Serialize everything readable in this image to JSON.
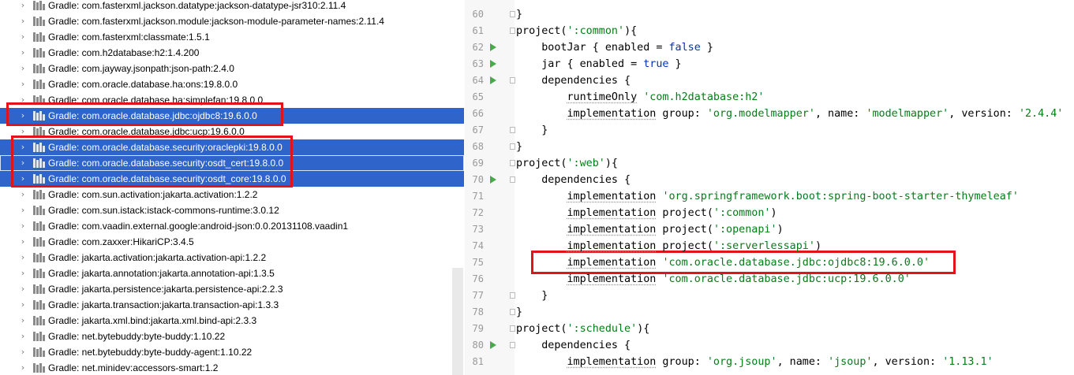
{
  "tree": {
    "items": [
      {
        "label": "Gradle: com.fasterxml.jackson.datatype:jackson-datatype-jsr310:2.11.4",
        "selected": false
      },
      {
        "label": "Gradle: com.fasterxml.jackson.module:jackson-module-parameter-names:2.11.4",
        "selected": false
      },
      {
        "label": "Gradle: com.fasterxml:classmate:1.5.1",
        "selected": false
      },
      {
        "label": "Gradle: com.h2database:h2:1.4.200",
        "selected": false
      },
      {
        "label": "Gradle: com.jayway.jsonpath:json-path:2.4.0",
        "selected": false
      },
      {
        "label": "Gradle: com.oracle.database.ha:ons:19.8.0.0",
        "selected": false
      },
      {
        "label": "Gradle: com.oracle.database.ha:simplefan:19.8.0.0",
        "selected": false
      },
      {
        "label": "Gradle: com.oracle.database.jdbc:ojdbc8:19.6.0.0",
        "selected": true
      },
      {
        "label": "Gradle: com.oracle.database.jdbc:ucp:19.6.0.0",
        "selected": false
      },
      {
        "label": "Gradle: com.oracle.database.security:oraclepki:19.8.0.0",
        "selected": true
      },
      {
        "label": "Gradle: com.oracle.database.security:osdt_cert:19.8.0.0",
        "selected": true
      },
      {
        "label": "Gradle: com.oracle.database.security:osdt_core:19.8.0.0",
        "selected": true
      },
      {
        "label": "Gradle: com.sun.activation:jakarta.activation:1.2.2",
        "selected": false
      },
      {
        "label": "Gradle: com.sun.istack:istack-commons-runtime:3.0.12",
        "selected": false
      },
      {
        "label": "Gradle: com.vaadin.external.google:android-json:0.0.20131108.vaadin1",
        "selected": false
      },
      {
        "label": "Gradle: com.zaxxer:HikariCP:3.4.5",
        "selected": false
      },
      {
        "label": "Gradle: jakarta.activation:jakarta.activation-api:1.2.2",
        "selected": false
      },
      {
        "label": "Gradle: jakarta.annotation:jakarta.annotation-api:1.3.5",
        "selected": false
      },
      {
        "label": "Gradle: jakarta.persistence:jakarta.persistence-api:2.2.3",
        "selected": false
      },
      {
        "label": "Gradle: jakarta.transaction:jakarta.transaction-api:1.3.3",
        "selected": false
      },
      {
        "label": "Gradle: jakarta.xml.bind:jakarta.xml.bind-api:2.3.3",
        "selected": false
      },
      {
        "label": "Gradle: net.bytebuddy:byte-buddy:1.10.22",
        "selected": false
      },
      {
        "label": "Gradle: net.bytebuddy:byte-buddy-agent:1.10.22",
        "selected": false
      },
      {
        "label": "Gradle: net.minidev:accessors-smart:1.2",
        "selected": false
      }
    ]
  },
  "editor": {
    "lines": [
      {
        "n": "60",
        "run": false,
        "fold": true,
        "segs": [
          {
            "t": "}"
          }
        ]
      },
      {
        "n": "61",
        "run": false,
        "fold": true,
        "segs": [
          {
            "t": "project("
          },
          {
            "t": "':common'",
            "c": "str"
          },
          {
            "t": "){"
          }
        ]
      },
      {
        "n": "62",
        "run": true,
        "fold": false,
        "segs": [
          {
            "t": "    bootJar { enabled = "
          },
          {
            "t": "false",
            "c": "kw"
          },
          {
            "t": " }"
          }
        ]
      },
      {
        "n": "63",
        "run": true,
        "fold": false,
        "segs": [
          {
            "t": "    jar { enabled = "
          },
          {
            "t": "true",
            "c": "kw"
          },
          {
            "t": " }"
          }
        ]
      },
      {
        "n": "64",
        "run": true,
        "fold": true,
        "segs": [
          {
            "t": "    dependencies {"
          }
        ]
      },
      {
        "n": "65",
        "run": false,
        "fold": false,
        "segs": [
          {
            "t": "        "
          },
          {
            "t": "runtimeOnly",
            "c": "ul"
          },
          {
            "t": " "
          },
          {
            "t": "'com.h2database:h2'",
            "c": "str"
          }
        ]
      },
      {
        "n": "66",
        "run": false,
        "fold": false,
        "segs": [
          {
            "t": "        "
          },
          {
            "t": "implementation",
            "c": "ul"
          },
          {
            "t": " group: "
          },
          {
            "t": "'org.modelmapper'",
            "c": "str"
          },
          {
            "t": ", name: "
          },
          {
            "t": "'modelmapper'",
            "c": "str"
          },
          {
            "t": ", version: "
          },
          {
            "t": "'2.4.4'",
            "c": "str"
          }
        ]
      },
      {
        "n": "67",
        "run": false,
        "fold": true,
        "segs": [
          {
            "t": "    }"
          }
        ]
      },
      {
        "n": "68",
        "run": false,
        "fold": true,
        "segs": [
          {
            "t": "}"
          }
        ]
      },
      {
        "n": "69",
        "run": false,
        "fold": true,
        "segs": [
          {
            "t": "project("
          },
          {
            "t": "':web'",
            "c": "str"
          },
          {
            "t": "){"
          }
        ]
      },
      {
        "n": "70",
        "run": true,
        "fold": true,
        "segs": [
          {
            "t": "    dependencies {"
          }
        ]
      },
      {
        "n": "71",
        "run": false,
        "fold": false,
        "segs": [
          {
            "t": "        "
          },
          {
            "t": "implementation",
            "c": "ul"
          },
          {
            "t": " "
          },
          {
            "t": "'org.springframework.boot:spring-boot-starter-thymeleaf'",
            "c": "str"
          }
        ]
      },
      {
        "n": "72",
        "run": false,
        "fold": false,
        "segs": [
          {
            "t": "        "
          },
          {
            "t": "implementation",
            "c": "ul"
          },
          {
            "t": " project("
          },
          {
            "t": "':common'",
            "c": "str"
          },
          {
            "t": ")"
          }
        ]
      },
      {
        "n": "73",
        "run": false,
        "fold": false,
        "segs": [
          {
            "t": "        "
          },
          {
            "t": "implementation",
            "c": "ul"
          },
          {
            "t": " project("
          },
          {
            "t": "':openapi'",
            "c": "str"
          },
          {
            "t": ")"
          }
        ]
      },
      {
        "n": "74",
        "run": false,
        "fold": false,
        "segs": [
          {
            "t": "        "
          },
          {
            "t": "implementation",
            "c": "ul"
          },
          {
            "t": " project("
          },
          {
            "t": "':serverlessapi'",
            "c": "str"
          },
          {
            "t": ")"
          }
        ]
      },
      {
        "n": "75",
        "run": false,
        "fold": false,
        "segs": [
          {
            "t": "        "
          },
          {
            "t": "implementation",
            "c": "ul"
          },
          {
            "t": " "
          },
          {
            "t": "'com.oracle.database.jdbc:ojdbc8:19.6.0.0'",
            "c": "str"
          }
        ]
      },
      {
        "n": "76",
        "run": false,
        "fold": false,
        "segs": [
          {
            "t": "        "
          },
          {
            "t": "implementation",
            "c": "ul"
          },
          {
            "t": " "
          },
          {
            "t": "'com.oracle.database.jdbc:ucp:19.6.0.0'",
            "c": "str"
          }
        ]
      },
      {
        "n": "77",
        "run": false,
        "fold": true,
        "segs": [
          {
            "t": "    }"
          }
        ]
      },
      {
        "n": "78",
        "run": false,
        "fold": true,
        "segs": [
          {
            "t": "}"
          }
        ]
      },
      {
        "n": "79",
        "run": false,
        "fold": true,
        "segs": [
          {
            "t": "project("
          },
          {
            "t": "':schedule'",
            "c": "str"
          },
          {
            "t": "){"
          }
        ]
      },
      {
        "n": "80",
        "run": true,
        "fold": true,
        "segs": [
          {
            "t": "    dependencies {"
          }
        ]
      },
      {
        "n": "81",
        "run": false,
        "fold": false,
        "segs": [
          {
            "t": "        "
          },
          {
            "t": "implementation",
            "c": "ul"
          },
          {
            "t": " group: "
          },
          {
            "t": "'org.jsoup'",
            "c": "str"
          },
          {
            "t": ", name: "
          },
          {
            "t": "'jsoup'",
            "c": "str"
          },
          {
            "t": ", version: "
          },
          {
            "t": "'1.13.1'",
            "c": "str"
          }
        ]
      }
    ]
  },
  "colors": {
    "selection": "#2f65ca",
    "annotation": "#e2141b",
    "string": "#067d17",
    "keyword": "#0033b3",
    "run_icon": "#47a94b"
  },
  "icons": {
    "tree_expander": "chevron-right-icon",
    "library": "library-icon",
    "gutter_run": "run-icon",
    "gutter_fold": "fold-icon"
  }
}
